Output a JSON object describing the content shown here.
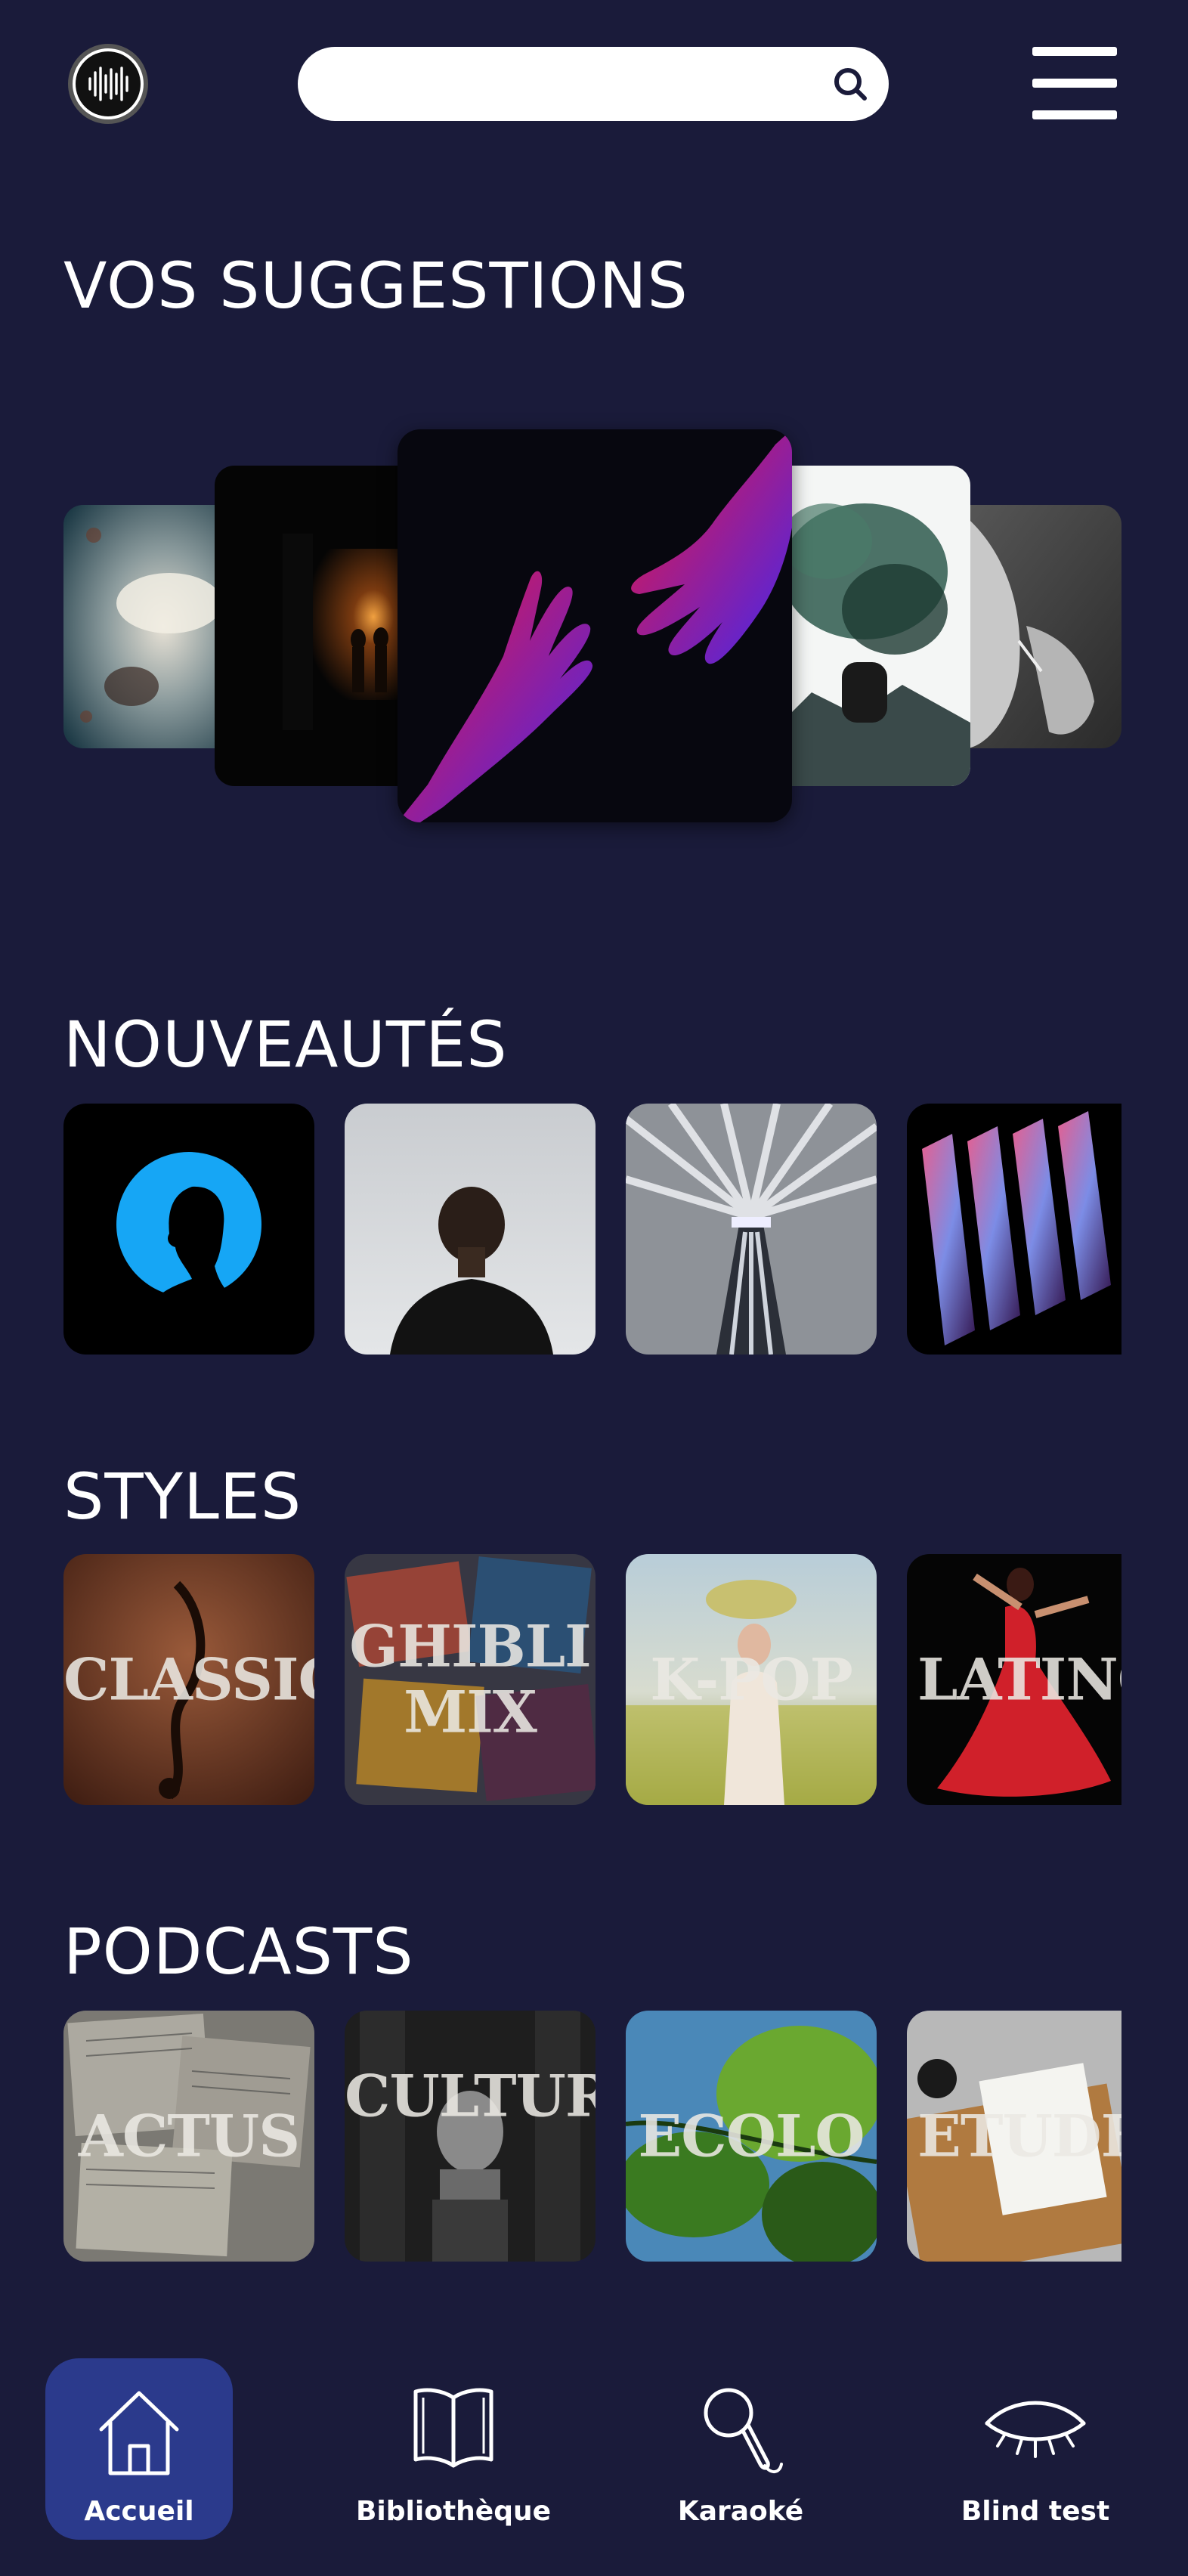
{
  "header": {
    "search_placeholder": "",
    "search_icon": "search-icon",
    "menu_icon": "hamburger-menu-icon",
    "logo_icon": "soundwave-logo-icon"
  },
  "sections": {
    "suggestions": "VOS SUGGESTIONS",
    "new": "NOUVEAUTÉS",
    "styles": "STYLES",
    "podcasts": "PODCASTS"
  },
  "styles": [
    {
      "label": "CLASSIC"
    },
    {
      "label": "GHIBLI MIX"
    },
    {
      "label": "K-POP"
    },
    {
      "label": "LATINO"
    }
  ],
  "podcasts": [
    {
      "label": "ACTUS"
    },
    {
      "label": "CULTURE"
    },
    {
      "label": "ECOLO"
    },
    {
      "label": "ETUDES"
    }
  ],
  "nav": [
    {
      "label": "Accueil",
      "icon": "home-icon",
      "active": true
    },
    {
      "label": "Bibliothèque",
      "icon": "book-icon",
      "active": false
    },
    {
      "label": "Karaoké",
      "icon": "microphone-icon",
      "active": false
    },
    {
      "label": "Blind test",
      "icon": "closed-eye-icon",
      "active": false
    }
  ],
  "colors": {
    "background": "#1a1b3a",
    "active_nav": "#2b3a8c",
    "text": "#ffffff"
  }
}
